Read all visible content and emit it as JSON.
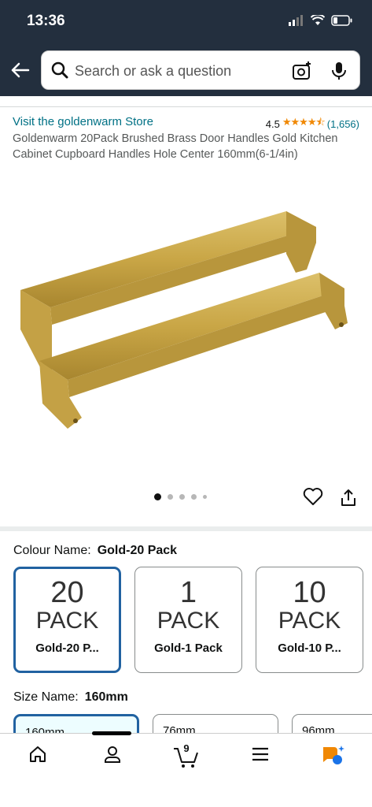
{
  "status": {
    "time": "13:36"
  },
  "search": {
    "placeholder": "Search or ask a question"
  },
  "product": {
    "store_link": "Visit the goldenwarm Store",
    "rating": "4.5",
    "rating_stars": "★★★★⯪",
    "review_count": "(1,656)",
    "title": "Goldenwarm 20Pack Brushed Brass Door Handles Gold Kitchen Cabinet Cupboard Handles Hole Center 160mm(6-1/4in)"
  },
  "gallery": {
    "image_count": 5,
    "active_index": 0
  },
  "colour": {
    "label": "Colour Name:",
    "selected": "Gold-20 Pack",
    "options": [
      {
        "big": "20",
        "pack": "PACK",
        "name": "Gold-20 P..."
      },
      {
        "big": "1",
        "pack": "PACK",
        "name": "Gold-1 Pack"
      },
      {
        "big": "10",
        "pack": "PACK",
        "name": "Gold-10 P..."
      }
    ]
  },
  "size": {
    "label": "Size Name:",
    "selected": "160mm",
    "options": [
      "160mm",
      "76mm",
      "96mm"
    ]
  },
  "nav": {
    "cart_count": "9"
  },
  "colors": {
    "header_bg": "#232f3e",
    "link": "#007185",
    "star": "#f08804",
    "selected_border": "#2162a1",
    "brass": "#c9a646"
  }
}
